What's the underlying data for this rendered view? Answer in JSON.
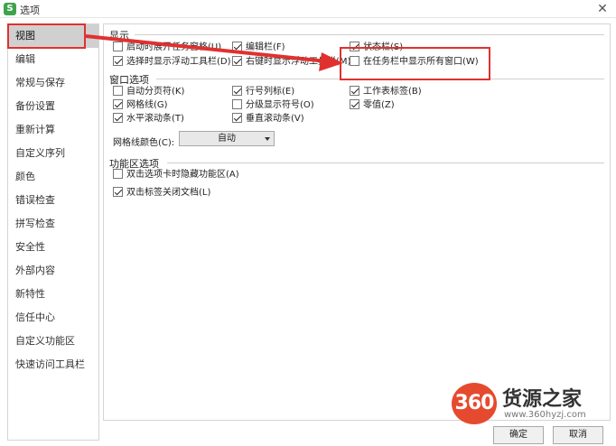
{
  "window": {
    "icon_glyph": "S",
    "title": "选项",
    "close_glyph": "✕"
  },
  "sidebar": {
    "items": [
      {
        "label": "视图",
        "active": true
      },
      {
        "label": "编辑"
      },
      {
        "label": "常规与保存"
      },
      {
        "label": "备份设置"
      },
      {
        "label": "重新计算"
      },
      {
        "label": "自定义序列"
      },
      {
        "label": "颜色"
      },
      {
        "label": "错误检查"
      },
      {
        "label": "拼写检查"
      },
      {
        "label": "安全性"
      },
      {
        "label": "外部内容"
      },
      {
        "label": "新特性"
      },
      {
        "label": "信任中心"
      },
      {
        "label": "自定义功能区"
      },
      {
        "label": "快速访问工具栏"
      }
    ]
  },
  "display": {
    "title": "显示",
    "opt_startup_taskpane": {
      "label": "启动时展开任务窗格(U)",
      "checked": false
    },
    "opt_formula_bar": {
      "label": "编辑栏(F)",
      "checked": true
    },
    "opt_status_bar": {
      "label": "状态栏(S)",
      "checked": true
    },
    "opt_float_toolbar": {
      "label": "选择时显示浮动工具栏(D)",
      "checked": true
    },
    "opt_rightclick_toolbar": {
      "label": "右键时显示浮动工具栏(M)",
      "checked": true
    },
    "opt_taskbar_windows": {
      "label": "在任务栏中显示所有窗口(W)",
      "checked": false
    }
  },
  "window_options": {
    "title": "窗口选项",
    "opt_page_breaks": {
      "label": "自动分页符(K)",
      "checked": false
    },
    "opt_row_col_headers": {
      "label": "行号列标(E)",
      "checked": true
    },
    "opt_sheet_tabs": {
      "label": "工作表标签(B)",
      "checked": true
    },
    "opt_gridlines": {
      "label": "网格线(G)",
      "checked": true
    },
    "opt_outline_symbols": {
      "label": "分级显示符号(O)",
      "checked": false
    },
    "opt_zero_values": {
      "label": "零值(Z)",
      "checked": true
    },
    "opt_hscroll": {
      "label": "水平滚动条(T)",
      "checked": true
    },
    "opt_vscroll": {
      "label": "垂直滚动条(V)",
      "checked": true
    },
    "gridline_color_label": "网格线颜色(C):",
    "gridline_color_value": "自动"
  },
  "ribbon_options": {
    "title": "功能区选项",
    "opt_dblclick_hide": {
      "label": "双击选项卡时隐藏功能区(A)",
      "checked": false
    },
    "opt_dblclick_close": {
      "label": "双击标签关闭文档(L)",
      "checked": true
    }
  },
  "footer": {
    "ok_label": "确定",
    "cancel_label": "取消"
  },
  "watermark": {
    "badge": "360",
    "brand": "货源之家",
    "url": "www.360hyzj.com"
  },
  "colors": {
    "highlight": "#e0312f",
    "active_nav": "#d0d0d0",
    "app_icon": "#3fa34d",
    "watermark_badge": "#e64a2e"
  }
}
